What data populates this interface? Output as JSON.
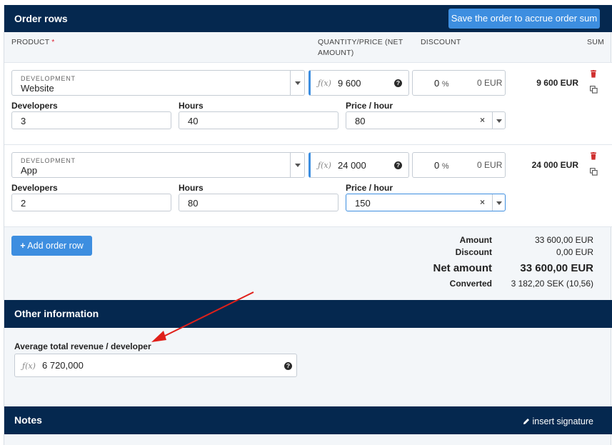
{
  "order_rows": {
    "title": "Order rows",
    "save_button": "Save the order to accrue order sum",
    "columns": {
      "product": "PRODUCT",
      "required_mark": "*",
      "quantity_price_1": "QUANTITY/PRICE (NET",
      "quantity_price_2": "AMOUNT)",
      "discount": "DISCOUNT",
      "sum": "SUM"
    },
    "rows": [
      {
        "category": "DEVELOPMENT",
        "product": "Website",
        "fx": "ƒ(x)",
        "quantity": "9 600",
        "discount_pct": "0",
        "discount_pct_unit": "%",
        "discount_amount": "0",
        "discount_currency": "EUR",
        "sum": "9 600 EUR",
        "developers_label": "Developers",
        "developers": "3",
        "hours_label": "Hours",
        "hours": "40",
        "price_label": "Price / hour",
        "price": "80"
      },
      {
        "category": "DEVELOPMENT",
        "product": "App",
        "fx": "ƒ(x)",
        "quantity": "24 000",
        "discount_pct": "0",
        "discount_pct_unit": "%",
        "discount_amount": "0",
        "discount_currency": "EUR",
        "sum": "24 000 EUR",
        "developers_label": "Developers",
        "developers": "2",
        "hours_label": "Hours",
        "hours": "80",
        "price_label": "Price / hour",
        "price": "150"
      }
    ],
    "add_row_button": "Add order row",
    "totals": {
      "amount_label": "Amount",
      "amount": "33 600,00 EUR",
      "discount_label": "Discount",
      "discount": "0,00 EUR",
      "net_label": "Net amount",
      "net": "33 600,00 EUR",
      "converted_label": "Converted",
      "converted": "3 182,20 SEK (10,56)"
    }
  },
  "other_information": {
    "title": "Other information",
    "avg_label": "Average total revenue / developer",
    "fx": "ƒ(x)",
    "avg_value": "6 720,000"
  },
  "notes": {
    "title": "Notes",
    "insert_signature": "insert signature"
  },
  "colors": {
    "header_bg": "#05284f",
    "accent": "#3d8ee0",
    "trash": "#d0302f",
    "annotation_arrow": "#e0201a"
  },
  "icons": {
    "help": "question-circle-icon",
    "trash": "trash-icon",
    "copy": "copy-icon",
    "clear": "x-icon",
    "caret": "chevron-down-icon",
    "pencil": "pencil-icon",
    "plus": "plus-icon"
  }
}
